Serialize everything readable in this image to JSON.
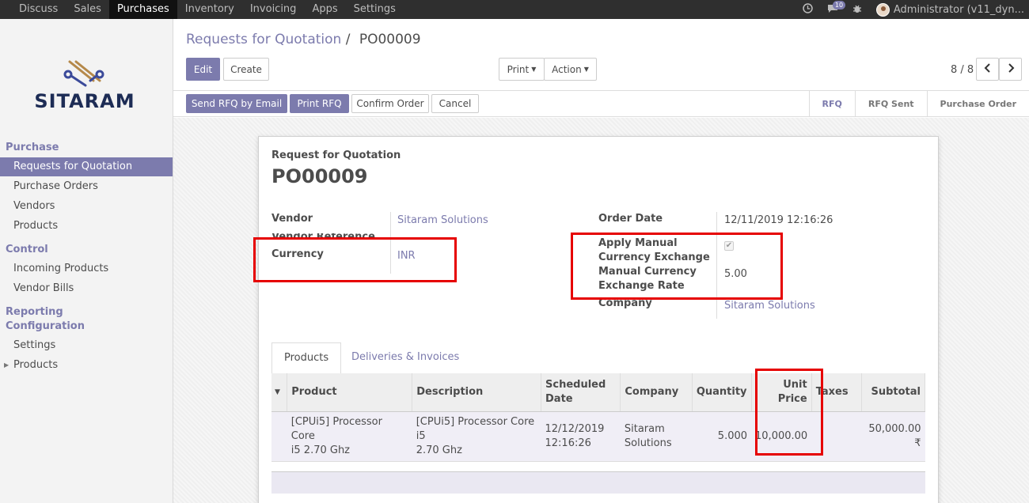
{
  "topbar": {
    "menu": [
      "Discuss",
      "Sales",
      "Purchases",
      "Inventory",
      "Invoicing",
      "Apps",
      "Settings"
    ],
    "active": "Purchases",
    "chat_count": "10",
    "user": "Administrator (v11_dyn..."
  },
  "sidebar": {
    "logo_text": "SITARAM",
    "sections": {
      "purchase": "Purchase",
      "control": "Control",
      "reporting": "Reporting",
      "configuration": "Configuration"
    },
    "items": {
      "rfq": "Requests for Quotation",
      "purchase_orders": "Purchase Orders",
      "vendors": "Vendors",
      "products": "Products",
      "incoming_products": "Incoming Products",
      "vendor_bills": "Vendor Bills",
      "settings": "Settings",
      "config_products": "Products"
    }
  },
  "control_panel": {
    "breadcrumb_parent": "Requests for Quotation",
    "breadcrumb_sep": "/",
    "breadcrumb_current": "PO00009",
    "edit": "Edit",
    "create": "Create",
    "print": "Print",
    "action": "Action",
    "pager": "8 / 8"
  },
  "statusbar": {
    "send_rfq": "Send RFQ by Email",
    "print_rfq": "Print RFQ",
    "confirm": "Confirm Order",
    "cancel": "Cancel",
    "steps": [
      "RFQ",
      "RFQ Sent",
      "Purchase Order"
    ],
    "current_step": "RFQ"
  },
  "form": {
    "doc_type": "Request for Quotation",
    "name": "PO00009",
    "vendor_label": "Vendor",
    "vendor": "Sitaram Solutions",
    "vendor_ref_label": "Vendor Reference",
    "currency_label": "Currency",
    "currency": "INR",
    "order_date_label": "Order Date",
    "order_date": "12/11/2019 12:16:26",
    "apply_manual_label_1": "Apply Manual",
    "apply_manual_label_2": "Currency Exchange",
    "apply_manual_checked": true,
    "rate_label_1": "Manual Currency",
    "rate_label_2": "Exchange Rate",
    "rate": "5.00",
    "company_label": "Company",
    "company": "Sitaram Solutions"
  },
  "tabs": [
    "Products",
    "Deliveries & Invoices"
  ],
  "lines": {
    "headers": {
      "product": "Product",
      "description": "Description",
      "scheduled_1": "Scheduled",
      "scheduled_2": "Date",
      "company": "Company",
      "quantity": "Quantity",
      "unit_1": "Unit",
      "unit_2": "Price",
      "taxes": "Taxes",
      "subtotal": "Subtotal"
    },
    "rows": [
      {
        "product_1": "[CPUi5] Processor Core",
        "product_2": "i5 2.70 Ghz",
        "description_1": "[CPUi5] Processor Core i5",
        "description_2": "2.70 Ghz",
        "date_1": "12/12/2019",
        "date_2": "12:16:26",
        "company_1": "Sitaram",
        "company_2": "Solutions",
        "quantity": "5.000",
        "unit_price": "10,000.00",
        "subtotal": "50,000.00 ₹"
      }
    ]
  },
  "colors": {
    "accent": "#7c7bad",
    "highlight": "#e60000",
    "topbar": "#2f2f2f"
  }
}
